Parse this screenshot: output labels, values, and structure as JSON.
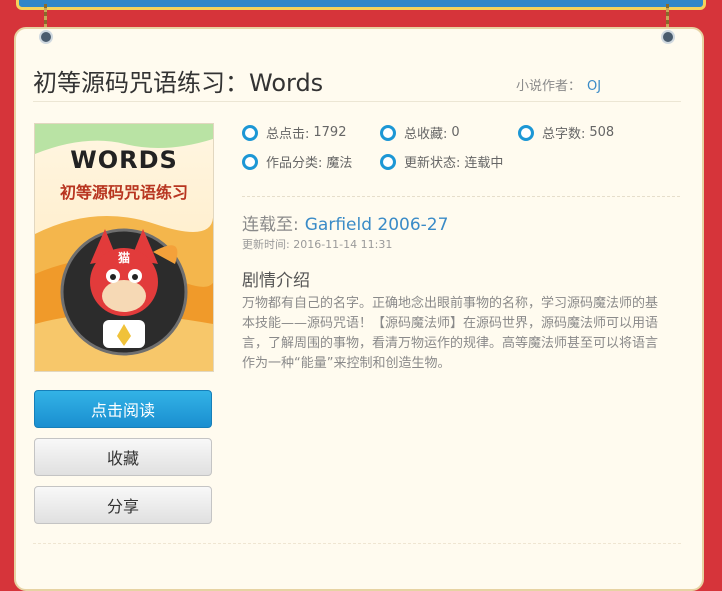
{
  "book": {
    "title": "初等源码咒语练习：Words",
    "author_label": "小说作者：",
    "author_name": "OJ",
    "cover": {
      "heading": "WORDS",
      "subtitle": "初等源码咒语练习",
      "badge_text": "猫"
    }
  },
  "stats": {
    "clicks_label": "总点击:",
    "clicks_value": "1792",
    "favorites_label": "总收藏:",
    "favorites_value": "0",
    "words_label": "总字数:",
    "words_value": "508",
    "category_label": "作品分类:",
    "category_value": "魔法",
    "status_label": "更新状态:",
    "status_value": "连载中"
  },
  "latest": {
    "label": "连载至:",
    "chapter": "Garfield 2006-27",
    "updated": "更新时间: 2016-11-14 11:31"
  },
  "synopsis": {
    "heading": "剧情介绍",
    "text": "万物都有自己的名字。正确地念出眼前事物的名称，学习源码魔法师的基本技能——源码咒语！【源码魔法师】在源码世界，源码魔法师可以用语言，了解周围的事物，看清万物运作的规律。高等魔法师甚至可以将语言作为一种“能量”来控制和创造生物。"
  },
  "actions": {
    "read": "点击阅读",
    "favorite": "收藏",
    "share": "分享"
  },
  "colors": {
    "background": "#d6343a",
    "panel": "#fffbef",
    "accent": "#1c97d5",
    "link": "#3a8bc7"
  }
}
